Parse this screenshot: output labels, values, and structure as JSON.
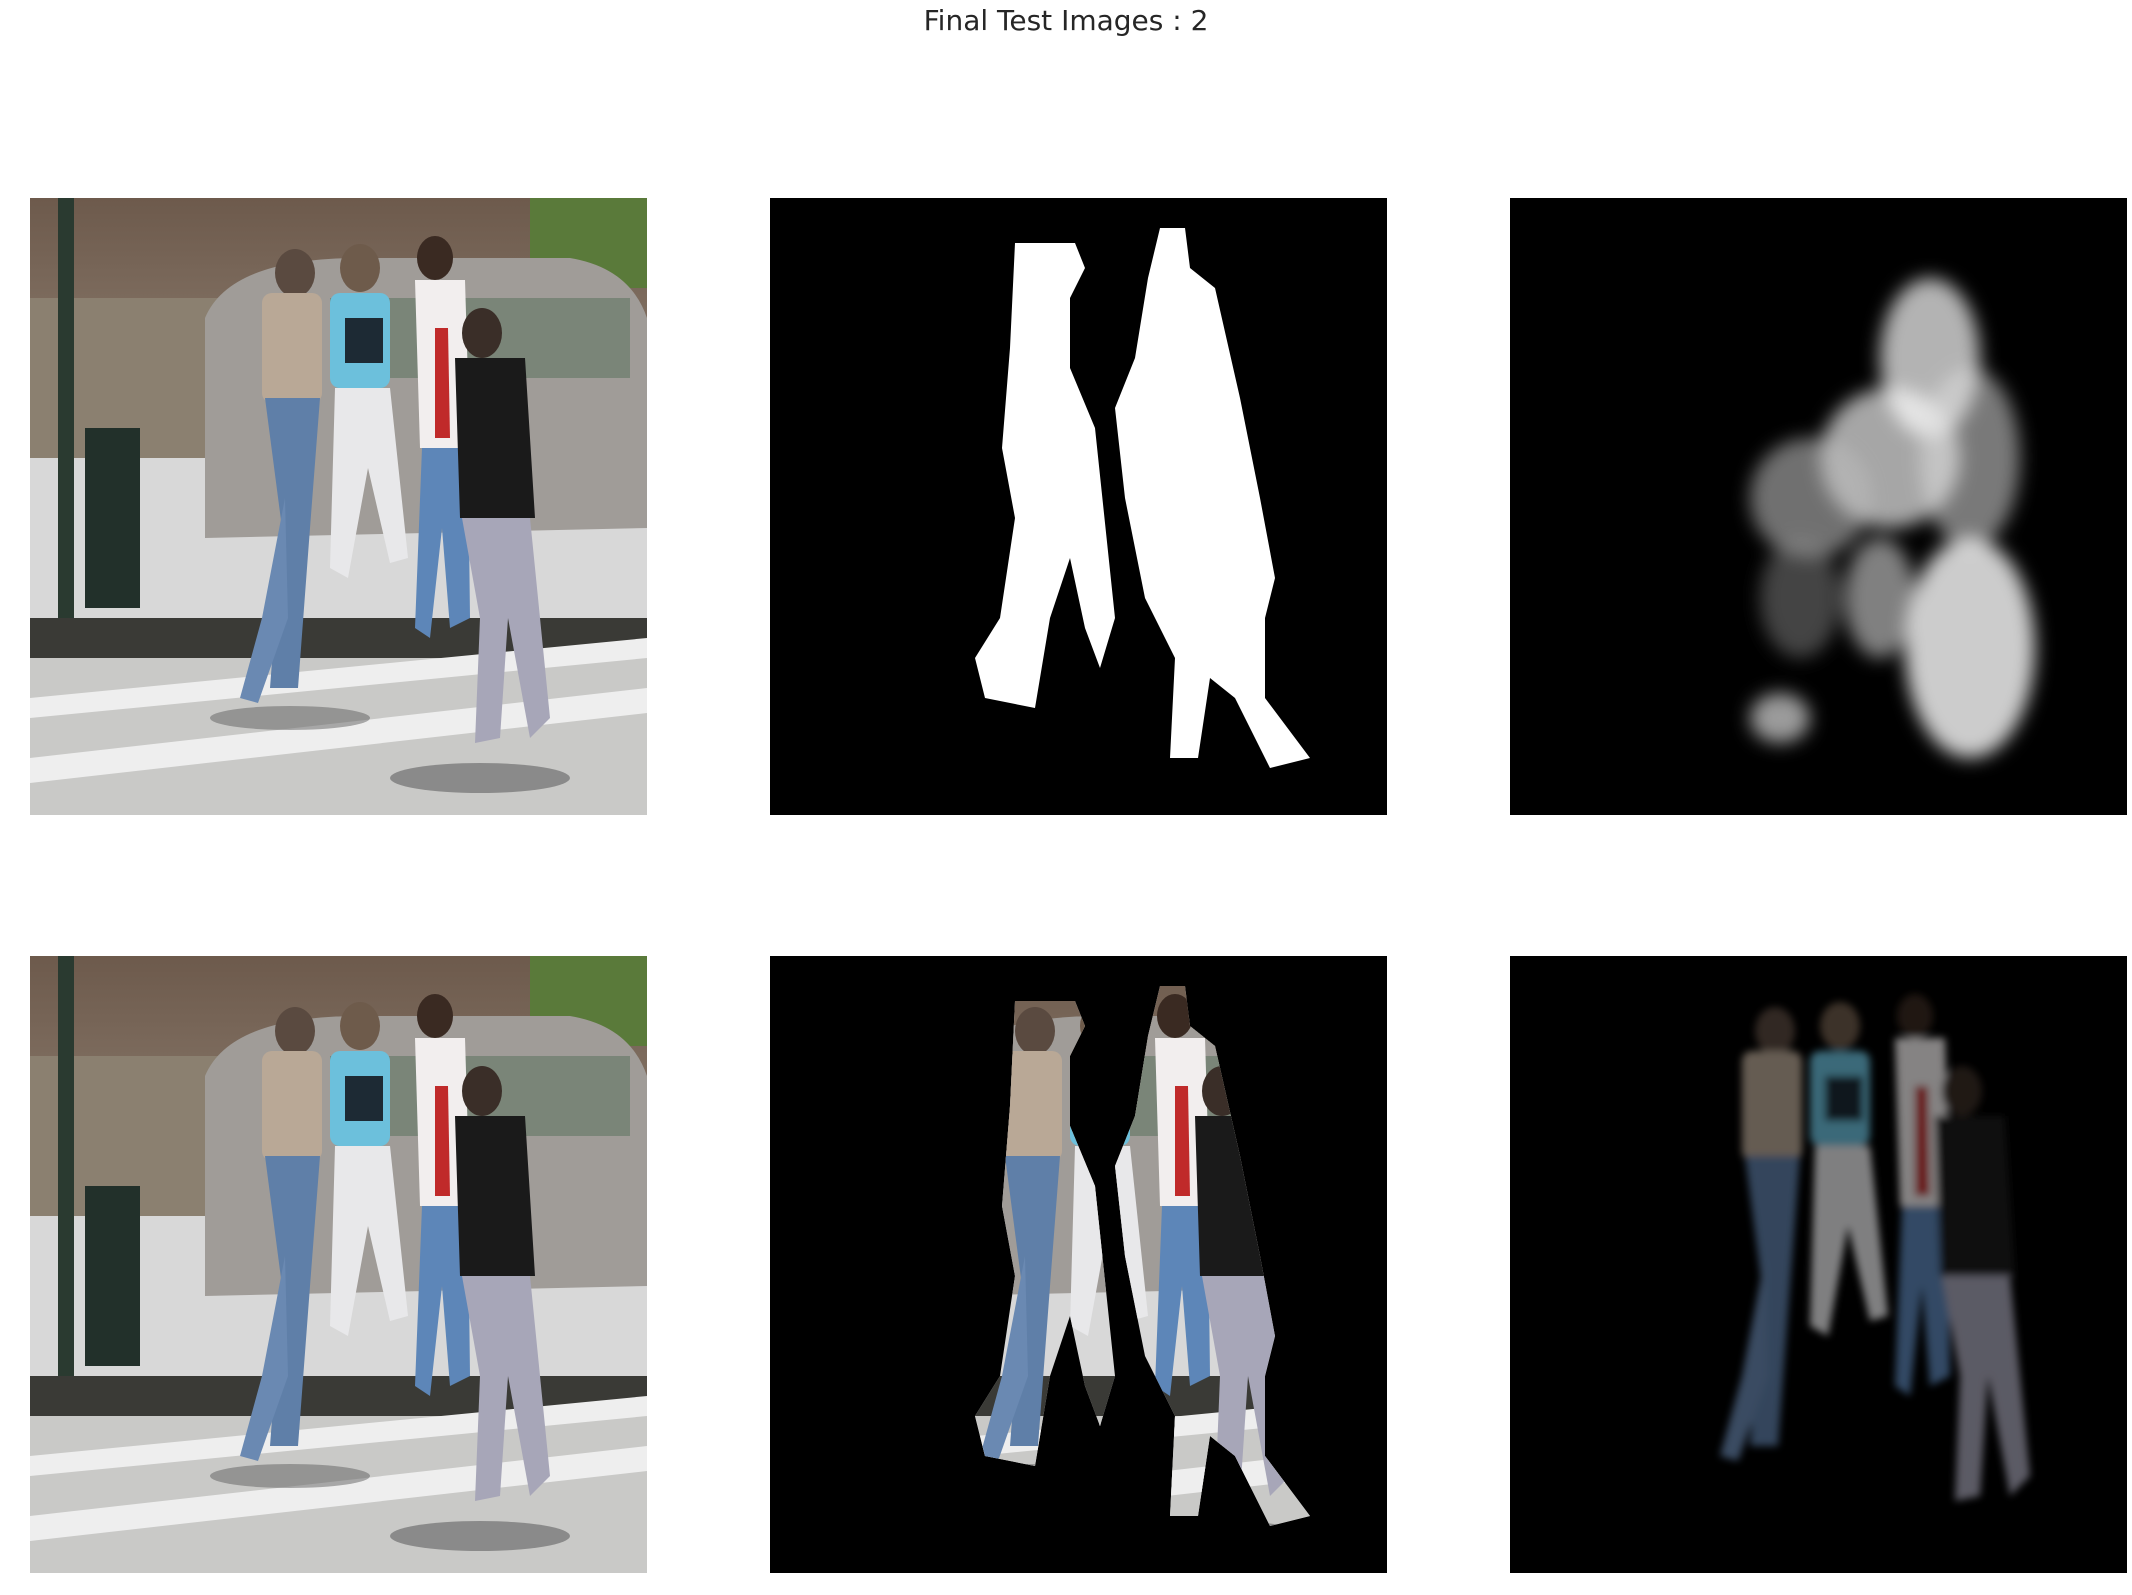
{
  "figure": {
    "title": "Final Test Images : 2",
    "background_color": "#ffffff",
    "layout": "2 rows x 3 columns",
    "panels": [
      {
        "name": "input-image-top",
        "content": "photo of four pedestrians crossing a street"
      },
      {
        "name": "ground-truth-mask",
        "content": "binary white silhouette mask on black"
      },
      {
        "name": "predicted-mask",
        "content": "blurry grayscale predicted mask on black"
      },
      {
        "name": "input-image-bottom",
        "content": "same photo of four pedestrians"
      },
      {
        "name": "ground-truth-masked-image",
        "content": "photo masked by ground truth, black background"
      },
      {
        "name": "predicted-masked-image",
        "content": "photo masked by prediction, dim and blurry"
      }
    ]
  }
}
